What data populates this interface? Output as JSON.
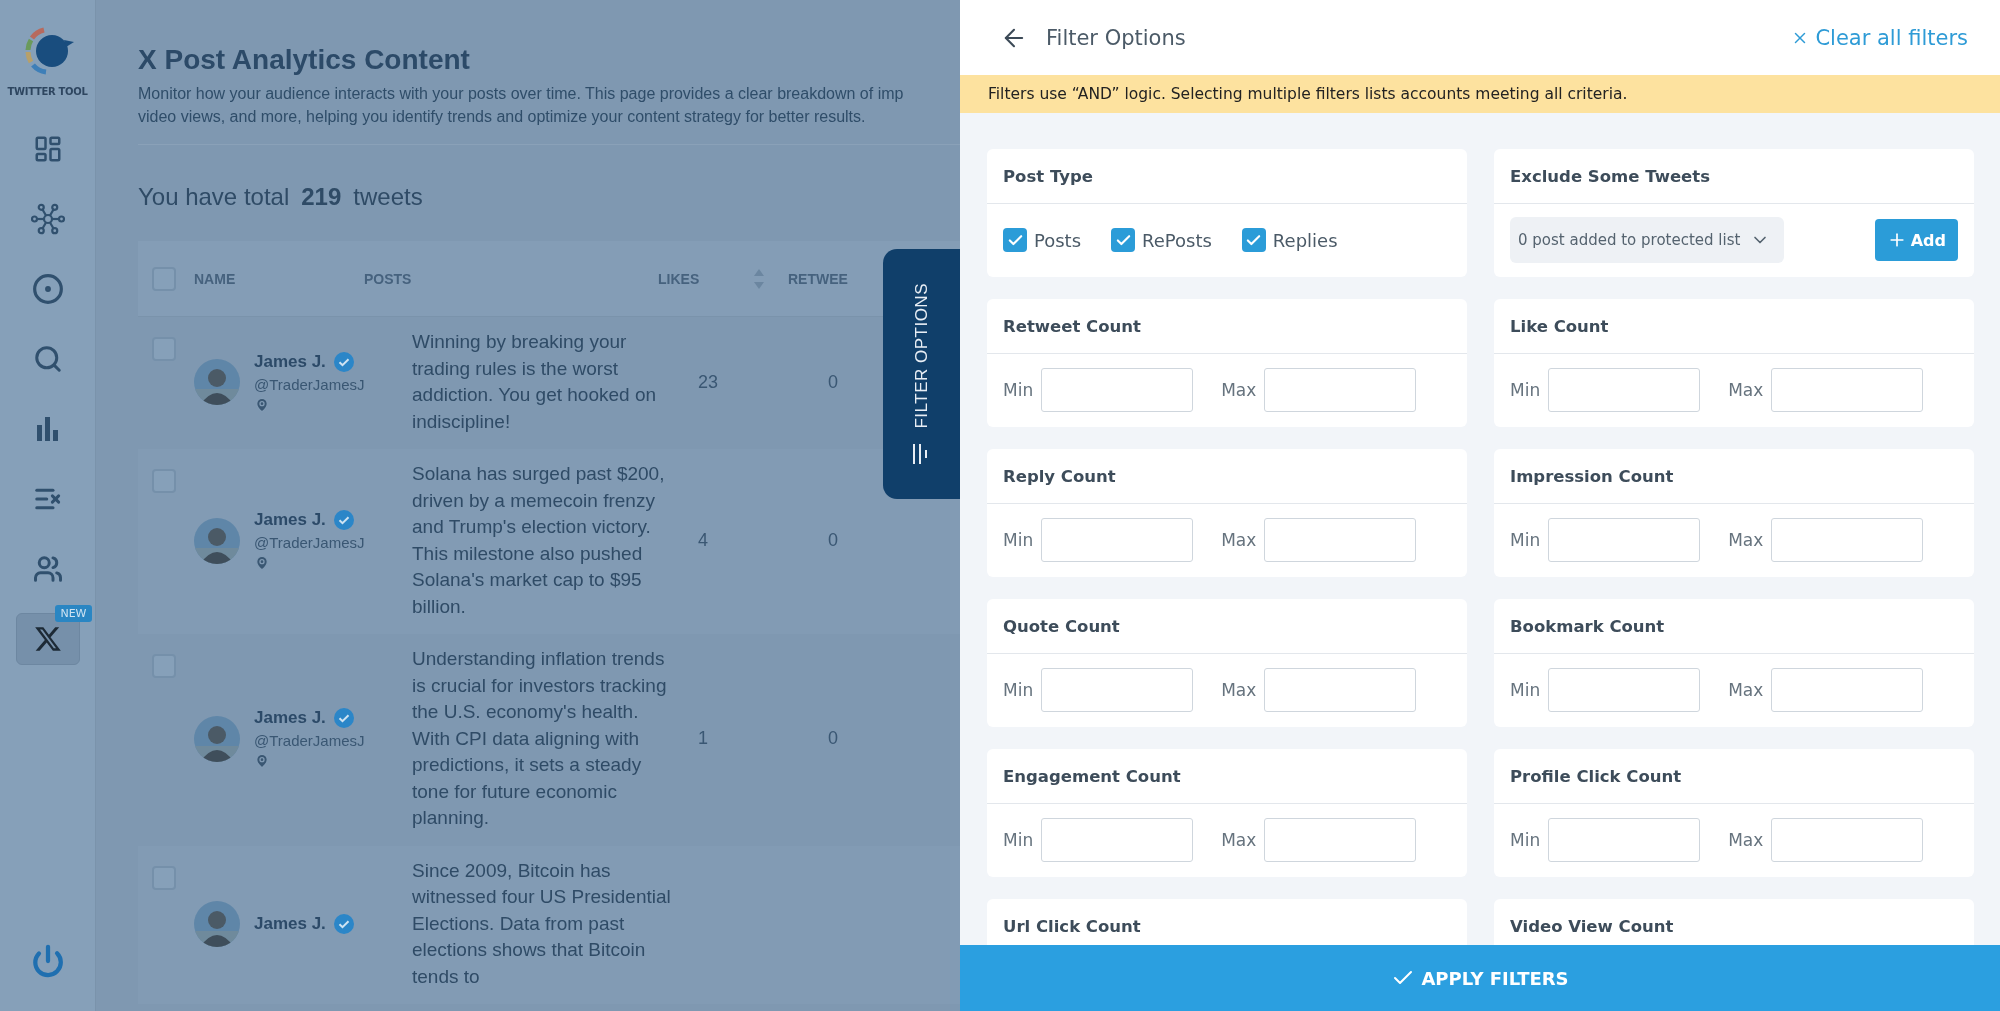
{
  "sidebar": {
    "logo_text": "TWITTER TOOL",
    "items": [
      {
        "selected": false
      },
      {
        "selected": false
      },
      {
        "selected": false
      },
      {
        "selected": false
      },
      {
        "selected": false
      },
      {
        "selected": false
      },
      {
        "selected": false
      },
      {
        "selected": true,
        "badge": "NEW"
      }
    ]
  },
  "page": {
    "title": "X Post Analytics Content",
    "description": [
      "Monitor how your audience interacts with your posts over time. This page provides a clear breakdown of imp",
      "video views, and more, helping you identify trends and optimize your content strategy for better results."
    ],
    "total": {
      "prefix": "You have total",
      "count": "219",
      "suffix": "tweets"
    },
    "table": {
      "select_all": {
        "checked": false
      },
      "columns": [
        {
          "label": "NAME"
        },
        {
          "label": "POSTS"
        },
        {
          "label": "LIKES",
          "sortable": true
        },
        {
          "label": "RETWEE"
        }
      ],
      "rows": [
        {
          "checked": false,
          "name": "James J.",
          "handle": "@TraderJamesJ",
          "post": "Winning by breaking your trading rules is the worst addiction. You get hooked on indiscipline!",
          "likes": "23",
          "retweets": "0"
        },
        {
          "checked": false,
          "name": "James J.",
          "handle": "@TraderJamesJ",
          "post": "Solana has surged past $200, driven by a memecoin frenzy and Trump's election victory. This milestone also pushed Solana's market cap to $95 billion.",
          "likes": "4",
          "retweets": "0"
        },
        {
          "checked": false,
          "name": "James J.",
          "handle": "@TraderJamesJ",
          "post": "Understanding inflation trends is crucial for investors tracking the U.S. economy's health. With CPI data aligning with predictions, it sets a steady tone for future economic planning.",
          "likes": "1",
          "retweets": "0"
        },
        {
          "checked": false,
          "name": "James J.",
          "post": "Since 2009, Bitcoin has witnessed four US Presidential Elections. Data from past elections shows that Bitcoin tends to"
        }
      ]
    }
  },
  "filter_tab": {
    "label": "FILTER OPTIONS"
  },
  "filter_panel": {
    "title": "Filter Options",
    "clear_label": "Clear all filters",
    "notice": "Filters use “AND” logic. Selecting multiple filters lists accounts meeting all criteria.",
    "post_type": {
      "title": "Post Type",
      "options": [
        {
          "label": "Posts",
          "checked": true
        },
        {
          "label": "RePosts",
          "checked": true
        },
        {
          "label": "Replies",
          "checked": true
        }
      ]
    },
    "exclude": {
      "title": "Exclude Some Tweets",
      "dropdown": "0 post added to protected list",
      "add_label": "Add"
    },
    "ranges": [
      {
        "title": "Retweet Count",
        "fields": [
          {
            "label": "Min"
          },
          {
            "label": "Max"
          }
        ]
      },
      {
        "title": "Like Count",
        "fields": [
          {
            "label": "Min"
          },
          {
            "label": "Max"
          }
        ]
      },
      {
        "title": "Reply Count",
        "fields": [
          {
            "label": "Min"
          },
          {
            "label": "Max"
          }
        ]
      },
      {
        "title": "Impression Count",
        "fields": [
          {
            "label": "Min"
          },
          {
            "label": "Max"
          }
        ]
      },
      {
        "title": "Quote Count",
        "fields": [
          {
            "label": "Min"
          },
          {
            "label": "Max"
          }
        ]
      },
      {
        "title": "Bookmark Count",
        "fields": [
          {
            "label": "Min"
          },
          {
            "label": "Max"
          }
        ]
      },
      {
        "title": "Engagement Count",
        "fields": [
          {
            "label": "Min"
          },
          {
            "label": "Max"
          }
        ]
      },
      {
        "title": "Profile Click Count",
        "fields": [
          {
            "label": "Min"
          },
          {
            "label": "Max"
          }
        ]
      },
      {
        "title": "Url Click Count"
      },
      {
        "title": "Video View Count"
      }
    ],
    "apply_label": "APPLY FILTERS"
  }
}
